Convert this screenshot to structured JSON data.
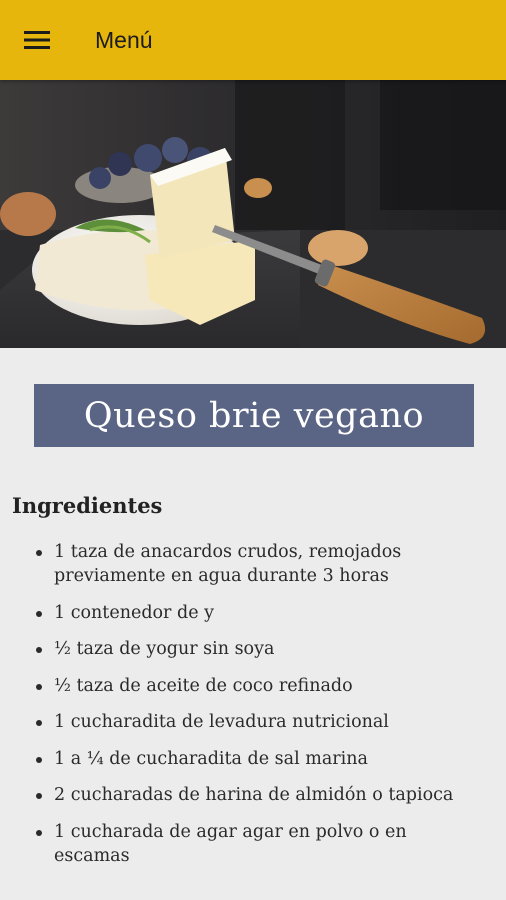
{
  "appbar": {
    "title": "Menú",
    "menu_icon": "hamburger-menu-icon",
    "background": "#e7b60c"
  },
  "hero": {
    "image": "brie-cheese-photo"
  },
  "recipe": {
    "title": "Queso brie vegano",
    "title_background": "#5a6485",
    "ingredients_heading": "Ingredientes",
    "ingredients": [
      "1 taza de anacardos crudos, remojados previamente en agua durante 3 horas",
      "1 contenedor de y",
      "½ taza de yogur sin soya",
      "½ taza de aceite de coco refinado",
      "1 cucharadita de levadura nutricional",
      "1 a ¼ de cucharadita de sal marina",
      "2 cucharadas de harina de almidón o tapioca",
      "1 cucharada de agar agar en polvo o en escamas"
    ]
  }
}
